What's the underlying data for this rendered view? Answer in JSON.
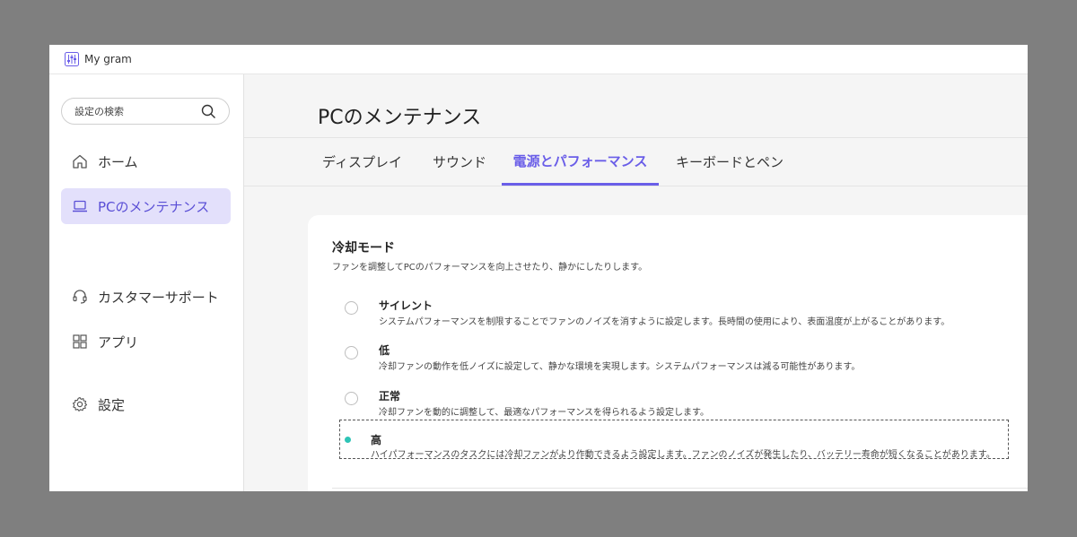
{
  "app": {
    "title": "My gram"
  },
  "sidebar": {
    "search_placeholder": "設定の検索",
    "items": [
      {
        "label": "ホーム",
        "icon": "home-icon"
      },
      {
        "label": "PCのメンテナンス",
        "icon": "laptop-icon",
        "active": true
      },
      {
        "label": "カスタマーサポート",
        "icon": "headset-icon"
      },
      {
        "label": "アプリ",
        "icon": "apps-grid-icon"
      },
      {
        "label": "設定",
        "icon": "gear-icon"
      }
    ]
  },
  "main": {
    "title": "PCのメンテナンス",
    "tabs": [
      {
        "label": "ディスプレイ"
      },
      {
        "label": "サウンド"
      },
      {
        "label": "電源とパフォーマンス",
        "active": true
      },
      {
        "label": "キーボードとペン"
      }
    ],
    "cooling": {
      "title": "冷却モード",
      "description": "ファンを調整してPCのパフォーマンスを向上させたり、静かにしたりします。",
      "options": [
        {
          "name": "サイレント",
          "description": "システムパフォーマンスを制限することでファンのノイズを消すように設定します。長時間の使用により、表面温度が上がることがあります。"
        },
        {
          "name": "低",
          "description": "冷却ファンの動作を低ノイズに設定して、静かな環境を実現します。システムパフォーマンスは減る可能性があります。"
        },
        {
          "name": "正常",
          "description": "冷却ファンを動的に調整して、最適なパフォーマンスを得られるよう設定します。"
        },
        {
          "name": "高",
          "description": "ハイパフォーマンスのタスクには冷却ファンがより作動できるよう設定します。ファンのノイズが発生したり、バッテリー寿命が短くなることがあります。",
          "selected": true
        }
      ]
    }
  },
  "colors": {
    "accent": "#6a5ee8",
    "active_bg": "#e3e0fb",
    "radio_selected": "#2ec4b6"
  }
}
